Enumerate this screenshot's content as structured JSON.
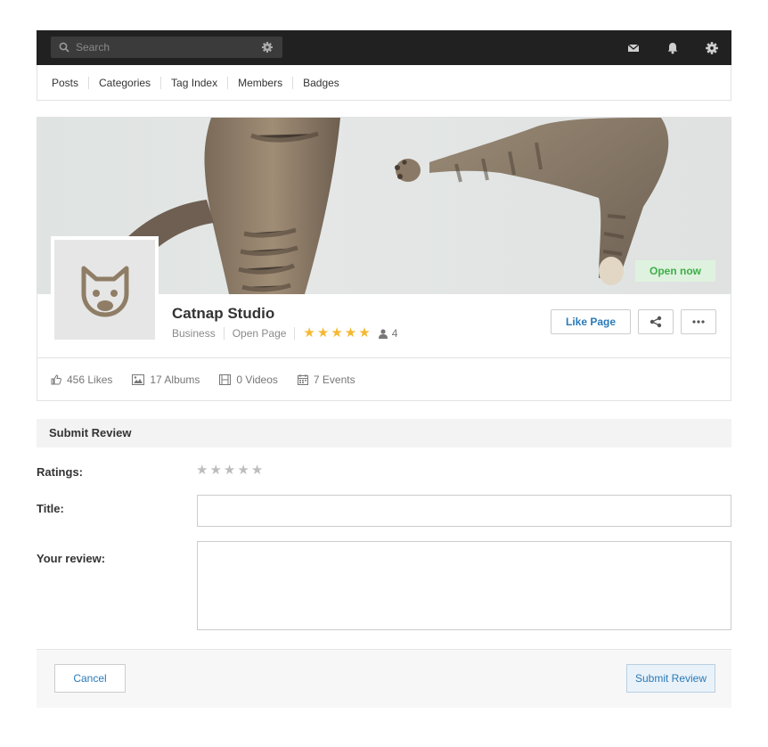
{
  "topbar": {
    "search_placeholder": "Search",
    "icons": [
      "search-icon",
      "gear-icon",
      "mail-icon",
      "bell-icon",
      "gear-icon"
    ]
  },
  "nav": {
    "items": [
      {
        "label": "Posts"
      },
      {
        "label": "Categories"
      },
      {
        "label": "Tag Index"
      },
      {
        "label": "Members"
      },
      {
        "label": "Badges"
      }
    ]
  },
  "profile": {
    "name": "Catnap Studio",
    "category": "Business",
    "page_type": "Open Page",
    "rating": 5,
    "reviewers": "4",
    "status_badge": "Open now",
    "status_color": "#3fae49",
    "like_button": "Like Page",
    "stats": {
      "likes": "456 Likes",
      "albums": "17 Albums",
      "videos": "0 Videos",
      "events": "7 Events"
    }
  },
  "review_form": {
    "heading": "Submit Review",
    "ratings_label": "Ratings:",
    "title_label": "Title:",
    "review_label": "Your review:",
    "title_value": "",
    "review_value": "",
    "cancel_label": "Cancel",
    "submit_label": "Submit Review"
  },
  "colors": {
    "accent": "#2a7ab9",
    "star": "#f5b831",
    "topbar": "#212121"
  }
}
